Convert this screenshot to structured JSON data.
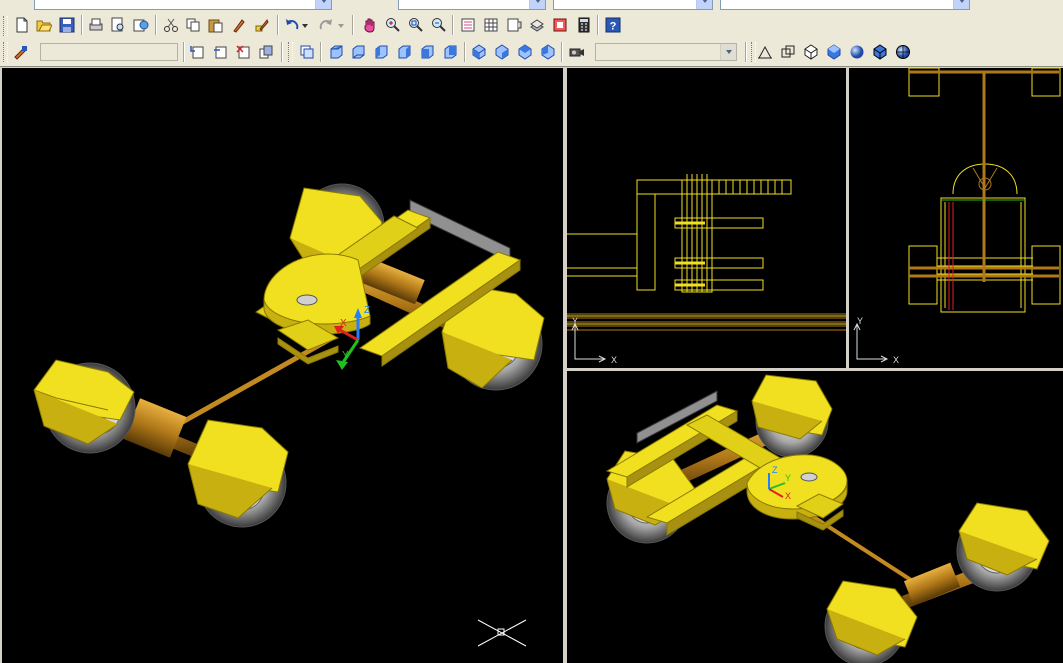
{
  "app": {
    "type": "cad-application",
    "colors": {
      "toolbar_bg": "#ece9d8",
      "viewport_bg": "#000000",
      "model_yellow": "#f0e020",
      "axle_brown": "#b07818",
      "tire_gray": "#c8c8c8",
      "ucs_x": "#e02020",
      "ucs_y": "#20c020",
      "ucs_z": "#2080ff"
    }
  },
  "toolbars": {
    "standard": [
      "new-icon",
      "open-icon",
      "save-icon",
      "plot-icon",
      "plot-preview-icon",
      "publish-icon",
      "cut-icon",
      "copy-icon",
      "paste-icon",
      "match-properties-icon",
      "block-editor-icon",
      "undo-icon",
      "redo-icon",
      "pan-icon",
      "zoom-realtime-icon",
      "zoom-window-icon",
      "zoom-previous-icon",
      "properties-icon",
      "design-center-icon",
      "tool-palettes-icon",
      "sheet-set-icon",
      "markup-icon",
      "calculator-icon",
      "help-icon"
    ],
    "views": [
      "named-views-icon",
      "top-view-icon",
      "bottom-view-icon",
      "left-view-icon",
      "right-view-icon",
      "front-view-icon",
      "back-view-icon",
      "sw-iso-icon",
      "se-iso-icon",
      "ne-iso-icon",
      "nw-iso-icon",
      "camera-icon"
    ],
    "shading": [
      "2d-wireframe-icon",
      "3d-wireframe-icon",
      "hidden-icon",
      "flat-shaded-icon",
      "gouraud-shaded-icon",
      "flat-edges-icon",
      "gouraud-edges-icon"
    ],
    "layer_combo": "",
    "style_combo": "",
    "view_combo": ""
  },
  "viewports": {
    "main": {
      "view": "3d-iso-shaded"
    },
    "front": {
      "view": "front-wireframe",
      "ucs": {
        "x": "X",
        "y": "Y"
      }
    },
    "side": {
      "view": "side-wireframe",
      "ucs": {
        "x": "X",
        "y": "Y"
      }
    },
    "iso": {
      "view": "3d-iso-shaded-2"
    }
  }
}
